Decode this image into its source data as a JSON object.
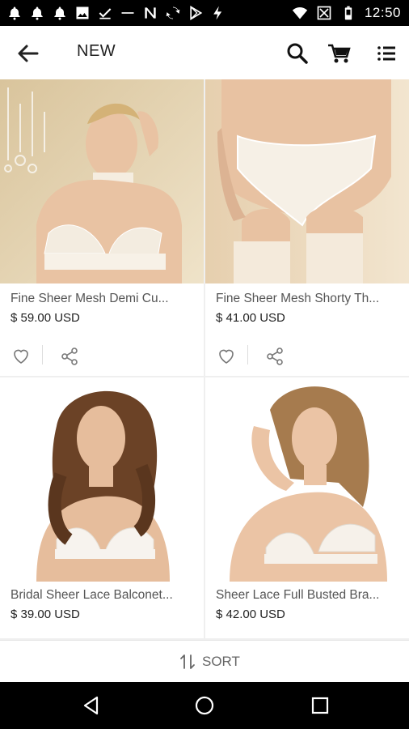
{
  "status_bar": {
    "time": "12:50",
    "left_icons": [
      "notification-bell-icon",
      "notification-bell-icon",
      "notification-bell-icon",
      "image-icon",
      "download-done-icon",
      "dash-icon",
      "n-icon",
      "sync-icon",
      "play-store-icon",
      "bolt-icon"
    ],
    "right_icons": [
      "wifi-icon",
      "no-signal-icon",
      "battery-icon"
    ]
  },
  "header": {
    "title": "NEW",
    "back_icon": "arrow-left-icon",
    "search_icon": "search-icon",
    "cart_icon": "cart-icon",
    "menu_icon": "list-icon"
  },
  "products": [
    {
      "name": "Fine Sheer Mesh Demi Cu...",
      "price": "$ 59.00 USD",
      "image": "woman-in-white-lace-bra-with-choker",
      "like_icon": "heart-icon",
      "share_icon": "share-icon"
    },
    {
      "name": "Fine Sheer Mesh Shorty Th...",
      "price": "$ 41.00 USD",
      "image": "white-lace-panty-and-stockings",
      "like_icon": "heart-icon",
      "share_icon": "share-icon"
    },
    {
      "name": "Bridal Sheer Lace Balconet...",
      "price": "$ 39.00 USD",
      "image": "brunette-woman-in-white-lace-bra"
    },
    {
      "name": "Sheer Lace Full Busted Bra...",
      "price": "$ 42.00 USD",
      "image": "blonde-woman-in-white-lace-bra"
    }
  ],
  "sort": {
    "label": "SORT",
    "icon": "sort-arrows-icon"
  },
  "nav_bar": {
    "back": "triangle-back-icon",
    "home": "circle-home-icon",
    "recents": "square-recents-icon"
  },
  "colors": {
    "status_bar": "#000000",
    "nav_bar": "#000000",
    "background": "#efefef",
    "card": "#ffffff",
    "text": "#222222",
    "muted": "#555555"
  }
}
